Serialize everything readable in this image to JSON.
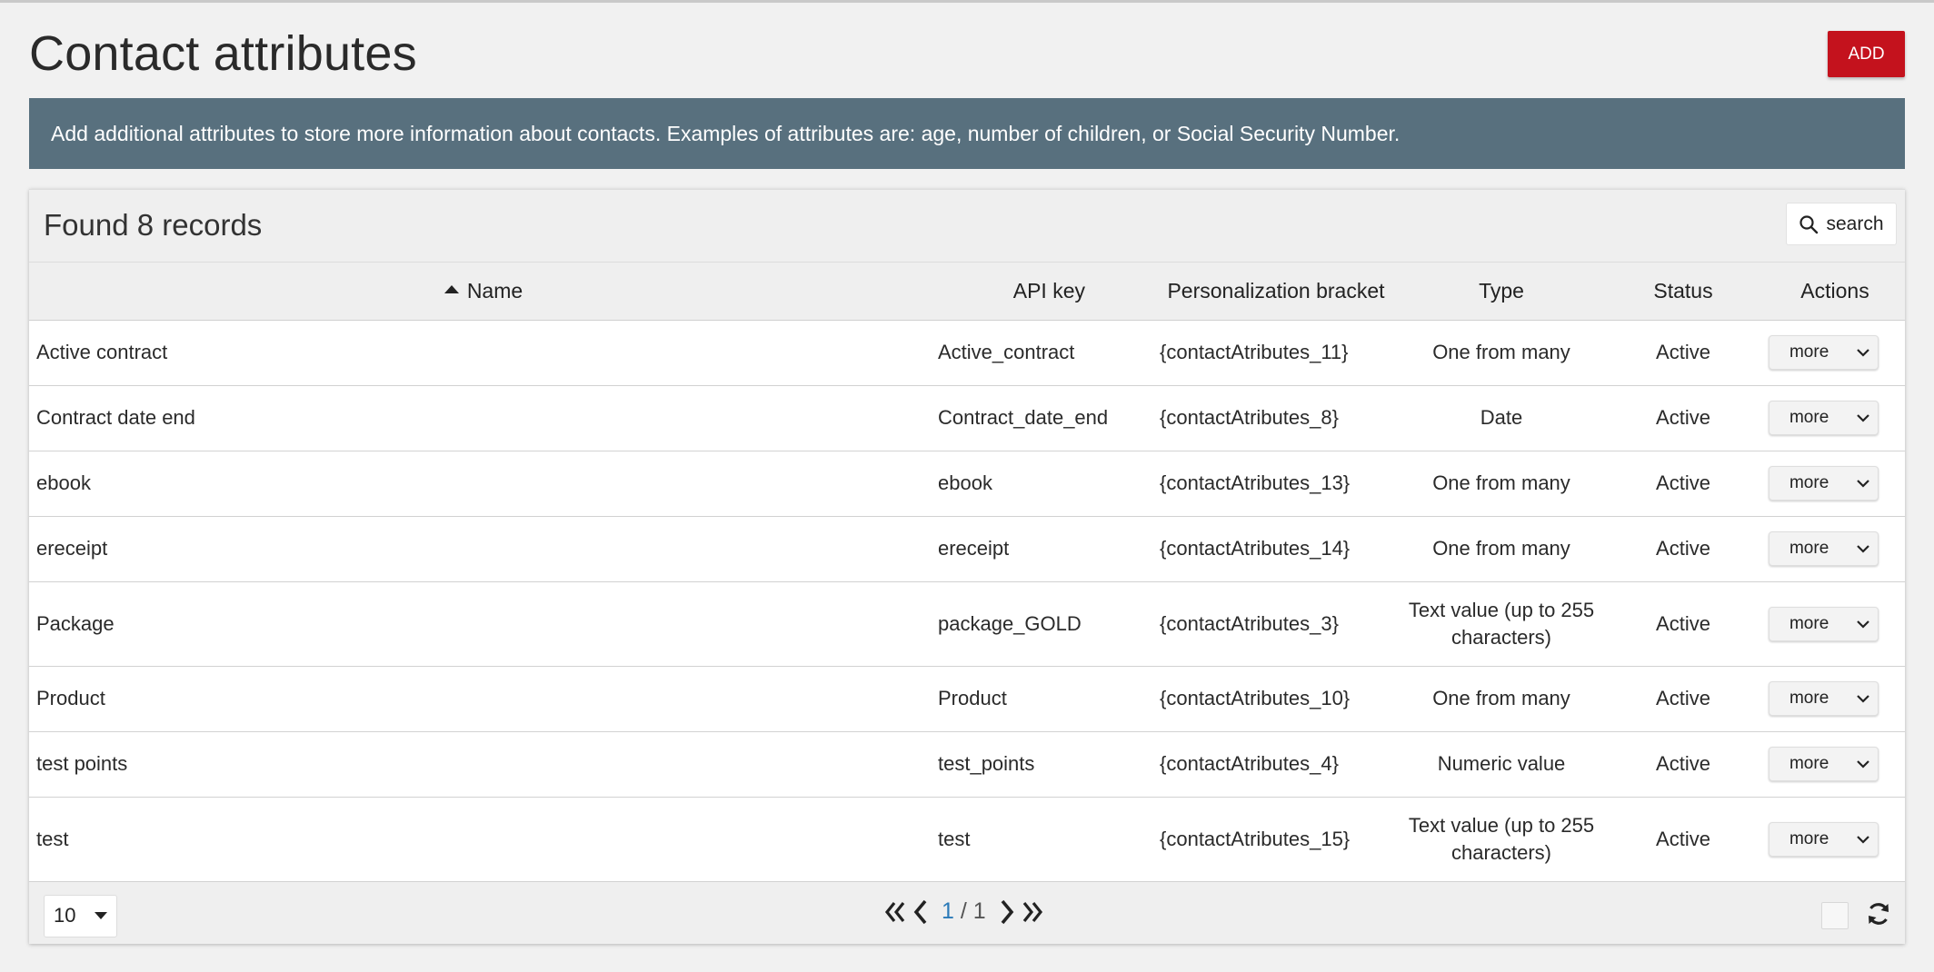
{
  "header": {
    "title": "Contact attributes",
    "add_label": "ADD"
  },
  "banner": {
    "text": "Add additional attributes to store more information about contacts. Examples of attributes are: age, number of children, or Social Security Number."
  },
  "panel": {
    "records_label": "Found 8 records",
    "search_label": "search"
  },
  "table": {
    "columns": {
      "name": "Name",
      "api_key": "API key",
      "bracket": "Personalization bracket",
      "type": "Type",
      "status": "Status",
      "actions": "Actions"
    },
    "action_label": "more",
    "rows": [
      {
        "name": "Active contract",
        "api_key": "Active_contract",
        "bracket": "{contactAtributes_11}",
        "type": "One from many",
        "status": "Active"
      },
      {
        "name": "Contract date end",
        "api_key": "Contract_date_end",
        "bracket": "{contactAtributes_8}",
        "type": "Date",
        "status": "Active"
      },
      {
        "name": "ebook",
        "api_key": "ebook",
        "bracket": "{contactAtributes_13}",
        "type": "One from many",
        "status": "Active"
      },
      {
        "name": "ereceipt",
        "api_key": "ereceipt",
        "bracket": "{contactAtributes_14}",
        "type": "One from many",
        "status": "Active"
      },
      {
        "name": "Package",
        "api_key": "package_GOLD",
        "bracket": "{contactAtributes_3}",
        "type": "Text value (up to 255 characters)",
        "status": "Active"
      },
      {
        "name": "Product",
        "api_key": "Product",
        "bracket": "{contactAtributes_10}",
        "type": "One from many",
        "status": "Active"
      },
      {
        "name": "test points",
        "api_key": "test_points",
        "bracket": "{contactAtributes_4}",
        "type": "Numeric value",
        "status": "Active"
      },
      {
        "name": "test",
        "api_key": "test",
        "bracket": "{contactAtributes_15}",
        "type": "Text value (up to 255 characters)",
        "status": "Active"
      }
    ]
  },
  "footer": {
    "page_size": "10",
    "current_page": "1",
    "separator": "/",
    "total_pages": "1"
  },
  "colors": {
    "accent": "#c4121d",
    "banner": "#58707e",
    "link": "#2a7ab8"
  },
  "icons": {
    "search": "search-icon",
    "more": "chevron-down-icon",
    "first": "double-chevron-left-icon",
    "prev": "chevron-left-icon",
    "next": "chevron-right-icon",
    "last": "double-chevron-right-icon",
    "refresh": "refresh-icon"
  }
}
